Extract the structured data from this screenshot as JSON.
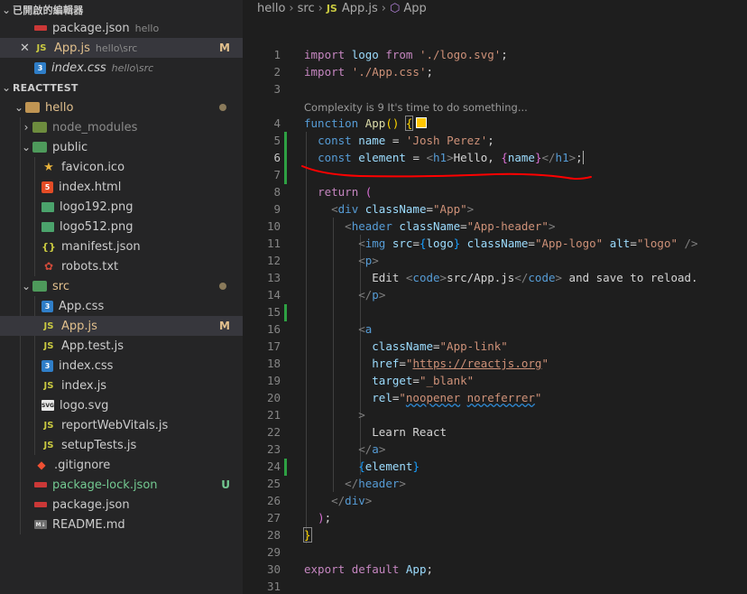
{
  "sidebar": {
    "open_editors_title": "已開啟的編輯器",
    "open_editors": [
      {
        "name": "package.json",
        "desc": "hello",
        "badge": "",
        "close": false
      },
      {
        "name": "App.js",
        "desc": "hello\\src",
        "badge": "M",
        "close": true
      },
      {
        "name": "index.css",
        "desc": "hello\\src",
        "badge": "",
        "close": false
      }
    ],
    "project_title": "REACTTEST",
    "tree": [
      {
        "name": "hello"
      },
      {
        "name": "node_modules"
      },
      {
        "name": "public"
      },
      {
        "name": "favicon.ico"
      },
      {
        "name": "index.html"
      },
      {
        "name": "logo192.png"
      },
      {
        "name": "logo512.png"
      },
      {
        "name": "manifest.json"
      },
      {
        "name": "robots.txt"
      },
      {
        "name": "src"
      },
      {
        "name": "App.css"
      },
      {
        "name": "App.js",
        "badge": "M"
      },
      {
        "name": "App.test.js"
      },
      {
        "name": "index.css"
      },
      {
        "name": "index.js"
      },
      {
        "name": "logo.svg"
      },
      {
        "name": "reportWebVitals.js"
      },
      {
        "name": "setupTests.js"
      },
      {
        "name": ".gitignore"
      },
      {
        "name": "package-lock.json",
        "badge": "U"
      },
      {
        "name": "package.json"
      },
      {
        "name": "README.md"
      }
    ]
  },
  "breadcrumb": {
    "root": "hello",
    "folder": "src",
    "file": "App.js",
    "symbol": "App"
  },
  "editor": {
    "codelens": "Complexity is 9 It's time to do something...",
    "line_numbers": [
      "1",
      "2",
      "3",
      "4",
      "5",
      "6",
      "7",
      "8",
      "9",
      "10",
      "11",
      "12",
      "13",
      "14",
      "15",
      "16",
      "17",
      "18",
      "19",
      "20",
      "21",
      "22",
      "23",
      "24",
      "25",
      "26",
      "27",
      "28",
      "29",
      "30",
      "31"
    ],
    "annotation_color": "#ff0000",
    "colors": {
      "keyword": "#c586c0",
      "storage": "#569cd6",
      "string": "#ce9178",
      "function": "#dcdcaa",
      "variable": "#9cdcfe",
      "component": "#4ec9b0"
    }
  }
}
